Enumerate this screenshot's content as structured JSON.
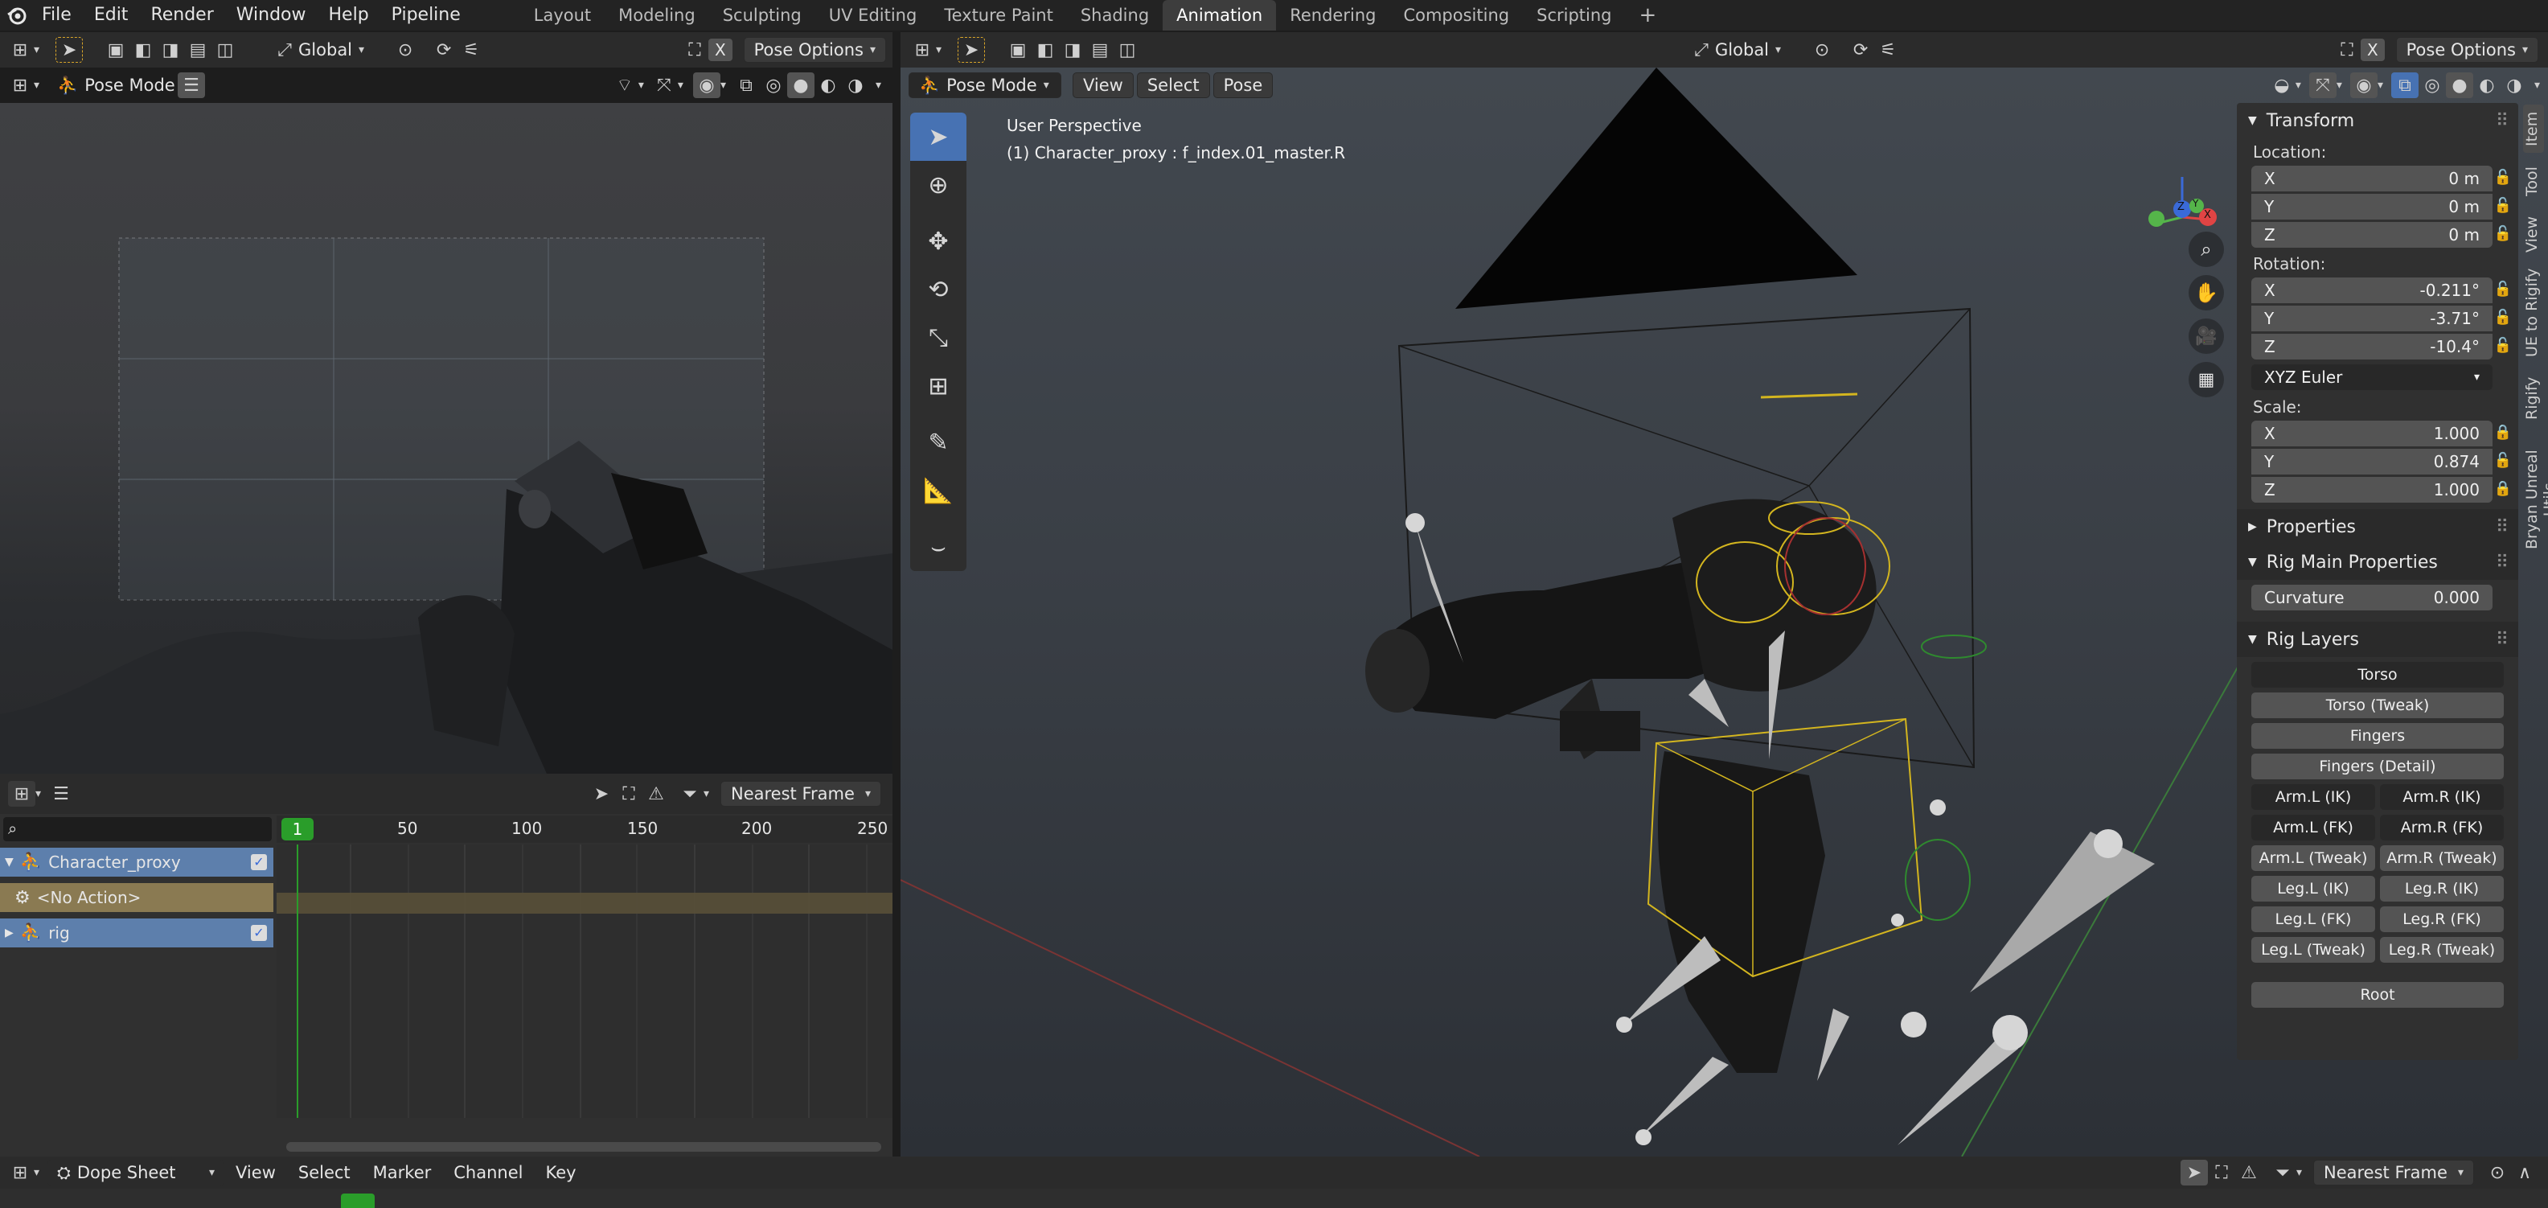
{
  "menubar": {
    "items": [
      "File",
      "Edit",
      "Render",
      "Window",
      "Help",
      "Pipeline"
    ],
    "workspaces": [
      "Layout",
      "Modeling",
      "Sculpting",
      "UV Editing",
      "Texture Paint",
      "Shading",
      "Animation",
      "Rendering",
      "Compositing",
      "Scripting"
    ],
    "active_workspace": "Animation",
    "add_label": "+"
  },
  "left_header": {
    "orientation": "Global",
    "x_label": "X",
    "pose_options": "Pose Options",
    "mode": "Pose Mode"
  },
  "right_header": {
    "orientation": "Global",
    "x_label": "X",
    "pose_options": "Pose Options",
    "mode": "Pose Mode",
    "menus": [
      "View",
      "Select",
      "Pose"
    ]
  },
  "viewport": {
    "perspective": "User Perspective",
    "object_info": "(1) Character_proxy : f_index.01_master.R",
    "gizmo": {
      "x": "X",
      "y": "Y",
      "z": "Z"
    }
  },
  "npanel": {
    "transform_title": "Transform",
    "location_label": "Location:",
    "location": [
      {
        "axis": "X",
        "value": "0 m"
      },
      {
        "axis": "Y",
        "value": "0 m"
      },
      {
        "axis": "Z",
        "value": "0 m"
      }
    ],
    "rotation_label": "Rotation:",
    "rotation": [
      {
        "axis": "X",
        "value": "-0.211°"
      },
      {
        "axis": "Y",
        "value": "-3.71°"
      },
      {
        "axis": "Z",
        "value": "-10.4°"
      }
    ],
    "rotation_mode": "XYZ Euler",
    "scale_label": "Scale:",
    "scale": [
      {
        "axis": "X",
        "value": "1.000"
      },
      {
        "axis": "Y",
        "value": "0.874"
      },
      {
        "axis": "Z",
        "value": "1.000"
      }
    ],
    "properties_title": "Properties",
    "rig_main_title": "Rig Main Properties",
    "curvature_label": "Curvature",
    "curvature_value": "0.000",
    "rig_layers_title": "Rig Layers",
    "rig_layers": {
      "torso": "Torso",
      "torso_tweak": "Torso (Tweak)",
      "fingers": "Fingers",
      "fingers_detail": "Fingers (Detail)",
      "arm_l_ik": "Arm.L (IK)",
      "arm_r_ik": "Arm.R (IK)",
      "arm_l_fk": "Arm.L (FK)",
      "arm_r_fk": "Arm.R (FK)",
      "arm_l_tweak": "Arm.L (Tweak)",
      "arm_r_tweak": "Arm.R (Tweak)",
      "leg_l_ik": "Leg.L (IK)",
      "leg_r_ik": "Leg.R (IK)",
      "leg_l_fk": "Leg.L (FK)",
      "leg_r_fk": "Leg.R (FK)",
      "leg_l_tweak": "Leg.L (Tweak)",
      "leg_r_tweak": "Leg.R (Tweak)",
      "root": "Root"
    },
    "side_tabs": [
      "Item",
      "Tool",
      "View",
      "UE to Rigify",
      "Rigify",
      "Bryan Unreal Utils"
    ]
  },
  "dopesheet_panel": {
    "snap": "Nearest Frame",
    "current_frame": "1",
    "ruler": [
      "50",
      "100",
      "150",
      "200",
      "250"
    ],
    "channels": [
      {
        "name": "Character_proxy"
      },
      {
        "name": "<No Action>"
      },
      {
        "name": "rig"
      }
    ]
  },
  "statusbar": {
    "editor": "Dope Sheet",
    "menus": [
      "View",
      "Select",
      "Marker",
      "Channel",
      "Key"
    ],
    "snap": "Nearest Frame"
  },
  "colors": {
    "accent_blue": "#4772b3",
    "frame_green": "#2a9d2a",
    "channel_blue": "#5d7fac",
    "no_action": "#8a7a52",
    "armature_yellow": "#d3b51f"
  }
}
